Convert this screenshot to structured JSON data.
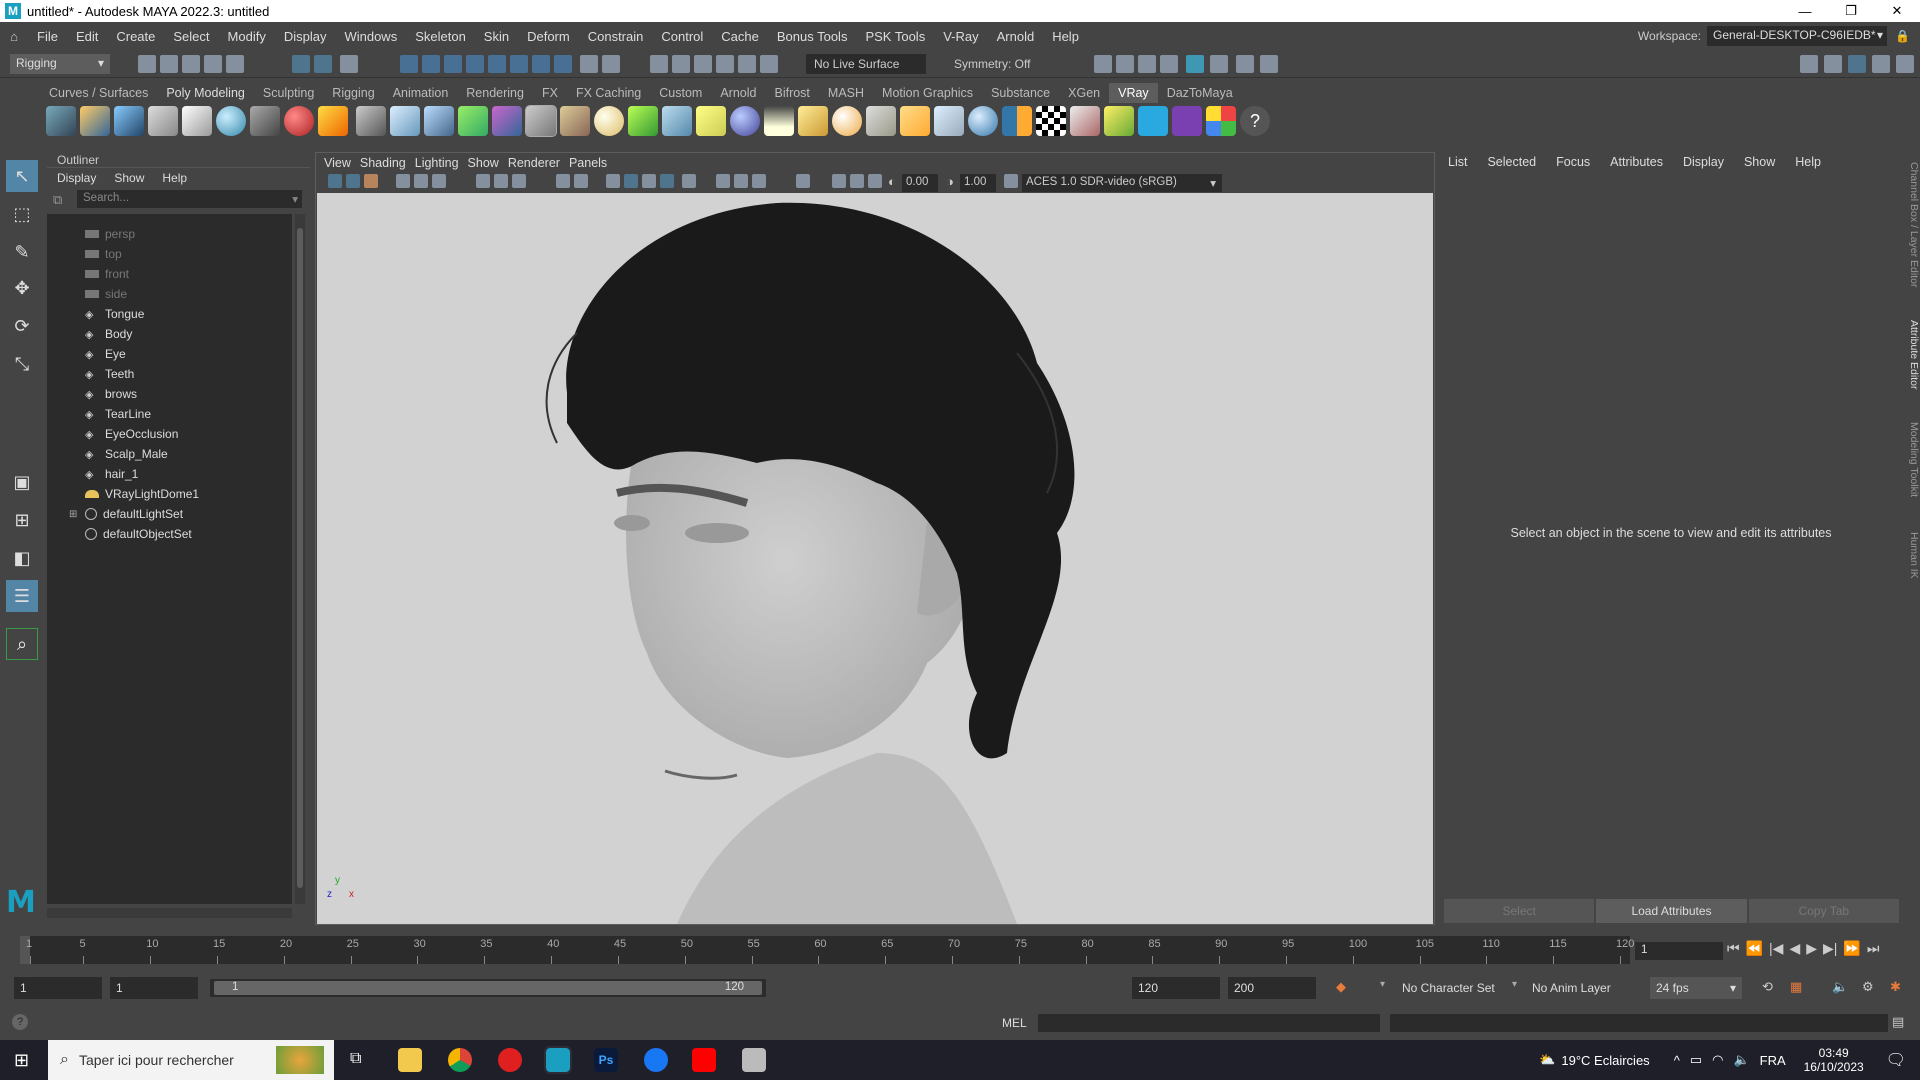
{
  "window": {
    "title": "untitled* - Autodesk MAYA 2022.3: untitled",
    "logo": "M",
    "minimize": "—",
    "maximize": "❐",
    "close": "✕"
  },
  "menubar": {
    "items": [
      "File",
      "Edit",
      "Create",
      "Select",
      "Modify",
      "Display",
      "Windows",
      "Skeleton",
      "Skin",
      "Deform",
      "Constrain",
      "Control",
      "Cache",
      "Bonus Tools",
      "PSK Tools",
      "V-Ray",
      "Arnold",
      "Help"
    ]
  },
  "workspace": {
    "label": "Workspace:",
    "value": "General-DESKTOP-C96IEDB*"
  },
  "statusline": {
    "mode": "Rigging",
    "live_surface": "No Live Surface",
    "symmetry": "Symmetry: Off"
  },
  "shelf": {
    "tabs": [
      "Curves / Surfaces",
      "Poly Modeling",
      "Sculpting",
      "Rigging",
      "Animation",
      "Rendering",
      "FX",
      "FX Caching",
      "Custom",
      "Arnold",
      "Bifrost",
      "MASH",
      "Motion Graphics",
      "Substance",
      "XGen",
      "VRay",
      "DazToMaya"
    ],
    "active_tab": "VRay"
  },
  "outliner": {
    "title": "Outliner",
    "menu": [
      "Display",
      "Show",
      "Help"
    ],
    "search_placeholder": "Search...",
    "items": [
      {
        "label": "persp",
        "type": "camera",
        "dim": true
      },
      {
        "label": "top",
        "type": "camera",
        "dim": true
      },
      {
        "label": "front",
        "type": "camera",
        "dim": true
      },
      {
        "label": "side",
        "type": "camera",
        "dim": true
      },
      {
        "label": "Tongue",
        "type": "mesh"
      },
      {
        "label": "Body",
        "type": "mesh"
      },
      {
        "label": "Eye",
        "type": "mesh"
      },
      {
        "label": "Teeth",
        "type": "mesh"
      },
      {
        "label": "brows",
        "type": "mesh"
      },
      {
        "label": "TearLine",
        "type": "mesh"
      },
      {
        "label": "EyeOcclusion",
        "type": "mesh"
      },
      {
        "label": "Scalp_Male",
        "type": "mesh"
      },
      {
        "label": "hair_1",
        "type": "mesh"
      },
      {
        "label": "VRayLightDome1",
        "type": "light"
      },
      {
        "label": "defaultLightSet",
        "type": "set",
        "expandable": true
      },
      {
        "label": "defaultObjectSet",
        "type": "set"
      }
    ]
  },
  "viewport": {
    "menu": [
      "View",
      "Shading",
      "Lighting",
      "Show",
      "Renderer",
      "Panels"
    ],
    "exposure": "0.00",
    "gamma": "1.00",
    "colorspace": "ACES 1.0 SDR-video (sRGB)"
  },
  "attribute_editor": {
    "menu": [
      "List",
      "Selected",
      "Focus",
      "Attributes",
      "Display",
      "Show",
      "Help"
    ],
    "message": "Select an object in the scene to view and edit its attributes",
    "buttons": [
      "Select",
      "Load Attributes",
      "Copy Tab"
    ],
    "side_tabs": [
      "Channel Box / Layer Editor",
      "Attribute Editor",
      "Modeling Toolkit",
      "Human IK"
    ]
  },
  "timeline": {
    "ticks": [
      "1",
      "5",
      "10",
      "15",
      "20",
      "25",
      "30",
      "35",
      "40",
      "45",
      "50",
      "55",
      "60",
      "65",
      "70",
      "75",
      "80",
      "85",
      "90",
      "95",
      "100",
      "105",
      "110",
      "115",
      "120"
    ],
    "current_frame": "1"
  },
  "range": {
    "start": "1",
    "playback_start": "1",
    "slider_start": "1",
    "slider_end": "120",
    "playback_end": "120",
    "end": "200",
    "character_set": "No Character Set",
    "anim_layer": "No Anim Layer",
    "fps": "24 fps"
  },
  "command": {
    "lang": "MEL",
    "help": "?"
  },
  "taskbar": {
    "search_placeholder": "Taper ici pour rechercher",
    "weather": "19°C Eclaircies",
    "lang": "FRA",
    "time": "03:49",
    "date": "16/10/2023"
  },
  "colors": {
    "maya_blue": "#1a9fc0",
    "selected_tool": "#5285a6",
    "active_shelf": "#5d5d5d"
  }
}
